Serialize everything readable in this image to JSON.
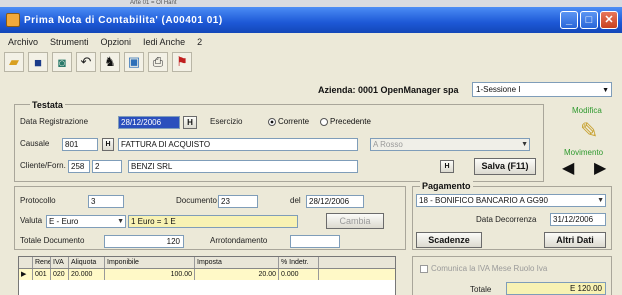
{
  "window": {
    "title": "Prima Nota di Contabilita' (A00401 01)",
    "bg_text": "Arte 01 = Ol Hant"
  },
  "menu": [
    "Archivo",
    "Strumenti",
    "Opzioni",
    "Iedi Anche",
    "2"
  ],
  "toolbar": {
    "icons": [
      "open-folder-icon",
      "save-icon",
      "scan-icon",
      "undo-icon",
      "search-binoculars-icon",
      "image-icon",
      "print-icon",
      "exit-icon"
    ]
  },
  "header": {
    "azienda": "Azienda: 0001 OpenManager spa",
    "sessione": "1-Sessione I"
  },
  "testata": {
    "title": "Testata",
    "data_reg_label": "Data Registrazione",
    "data_reg_value": "28/12/2006",
    "cal_btn": "H",
    "esercizio_label": "Esercizio",
    "corrente": "Corrente",
    "precedente": "Precedente",
    "causale_label": "Causale",
    "causale_code": "801",
    "causale_desc": "FATTURA DI ACQUISTO",
    "causale_extra": "A Rosso",
    "cliente_label": "Cliente/Forn.",
    "cliente_code": "258",
    "cliente_sub": "2",
    "cliente_name": "BENZI SRL",
    "salva_btn": "Salva (F11)",
    "modifica": "Modifica",
    "movimento": "Movimento"
  },
  "protocollo": {
    "prot_label": "Protocollo",
    "prot_value": "3",
    "doc_label": "Documento",
    "doc_value": "23",
    "del_label": "del",
    "del_value": "28/12/2006",
    "valuta_label": "Valuta",
    "valuta_value": "E - Euro",
    "cambio_value": "1 Euro = 1 E",
    "cambia_btn": "Cambia",
    "totale_label": "Totale Documento",
    "totale_value": "120",
    "arr_label": "Arrotondamento"
  },
  "pagamento": {
    "title": "Pagamento",
    "value": "18 - BONIFICO BANCARIO A GG90",
    "decorrenza_label": "Data Decorrenza",
    "decorrenza_value": "31/12/2006",
    "scadenze_btn": "Scadenze",
    "altri_btn": "Altri Dati"
  },
  "grid": {
    "headers": [
      "",
      "Rene",
      "IVA",
      "Aliquota",
      "Imponibile",
      "Imposta",
      "% Indetr."
    ],
    "row": [
      "▶",
      "001",
      "020",
      "20.000",
      "100.00",
      "20.00",
      "0.000"
    ]
  },
  "footer": {
    "check_label": "Comunica la IVA Mese Ruolo Iva",
    "totale_label": "Totale",
    "totale_value": "E 120.00"
  }
}
